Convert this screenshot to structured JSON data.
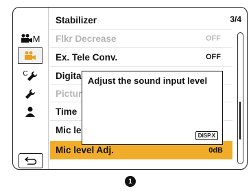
{
  "page_indicator": "3/4",
  "sidebar": {
    "tabs": [
      {
        "name": "movie-manual",
        "label": "M"
      },
      {
        "name": "camera-settings",
        "label": ""
      },
      {
        "name": "custom-tools",
        "label": "C"
      },
      {
        "name": "tools",
        "label": ""
      },
      {
        "name": "my-menu",
        "label": ""
      }
    ]
  },
  "menu": {
    "items": [
      {
        "label": "Stabilizer",
        "value": ""
      },
      {
        "label": "Flkr Decrease",
        "value": "OFF"
      },
      {
        "label": "Ex. Tele Conv.",
        "value": "OFF"
      },
      {
        "label": "Digita",
        "value": ""
      },
      {
        "label": "Pictur",
        "value": ""
      },
      {
        "label": "Time",
        "value": ""
      },
      {
        "label": "Mic le",
        "value": ""
      },
      {
        "label": "Mic level Adj.",
        "value": "0dB"
      }
    ]
  },
  "popup": {
    "message": "Adjust the sound input level",
    "disp_button": "DISP.X"
  },
  "callout": "1",
  "colors": {
    "highlight": "#f1ad2a",
    "active_tab_icon": "#e8a020",
    "dim_text": "#b5b5b5"
  }
}
